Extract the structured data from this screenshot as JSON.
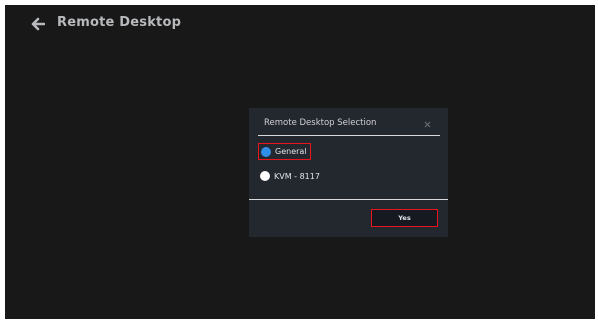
{
  "header": {
    "back_icon": "arrow-left-icon",
    "title": "Remote Desktop"
  },
  "dialog": {
    "title": "Remote Desktop Selection",
    "close_icon": "close-icon",
    "options": [
      {
        "label": "General",
        "selected": true
      },
      {
        "label": "KVM - 8117",
        "selected": false
      }
    ],
    "confirm_label": "Yes"
  },
  "colors": {
    "background": "#181818",
    "dialog": "#23272e",
    "radio_selected": "#2f8fe8",
    "highlight": "#e8141e",
    "title_text": "#b7b9bc"
  }
}
